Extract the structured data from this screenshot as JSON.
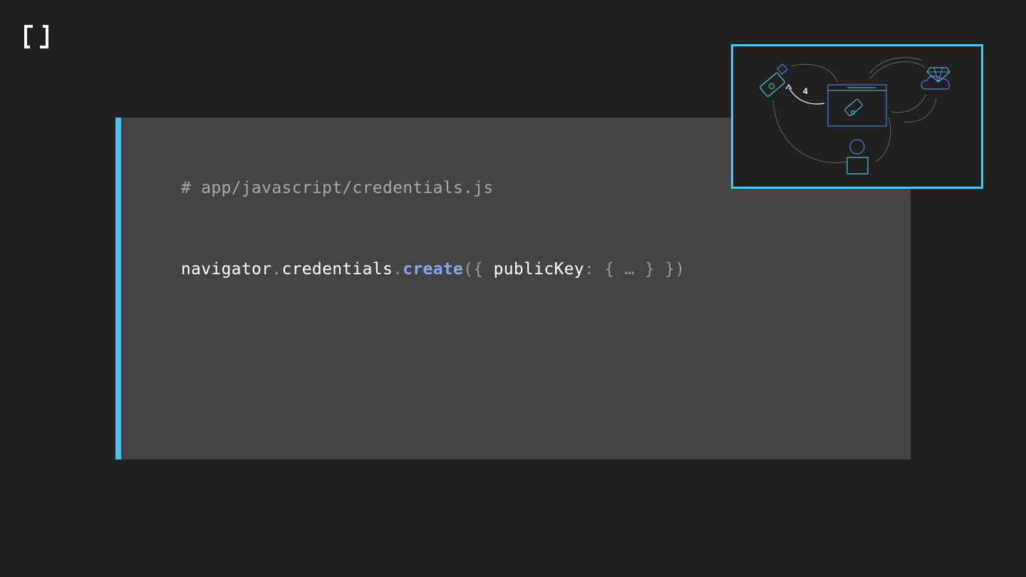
{
  "code": {
    "comment": "# app/javascript/credentials.js",
    "call": {
      "object": "navigator",
      "dot1": ".",
      "property": "credentials",
      "dot2": ".",
      "method": "create",
      "args_open": "({ ",
      "key": "publicKey",
      "args_rest": ": { … } })"
    }
  },
  "diagram": {
    "step_label": "4",
    "icons": [
      "security-key-icon",
      "browser-window-icon",
      "cloud-gem-icon",
      "user-icon"
    ]
  },
  "colors": {
    "background": "#212121",
    "panel": "#444444",
    "accent": "#4fc3ea",
    "method": "#7ea9ee"
  }
}
